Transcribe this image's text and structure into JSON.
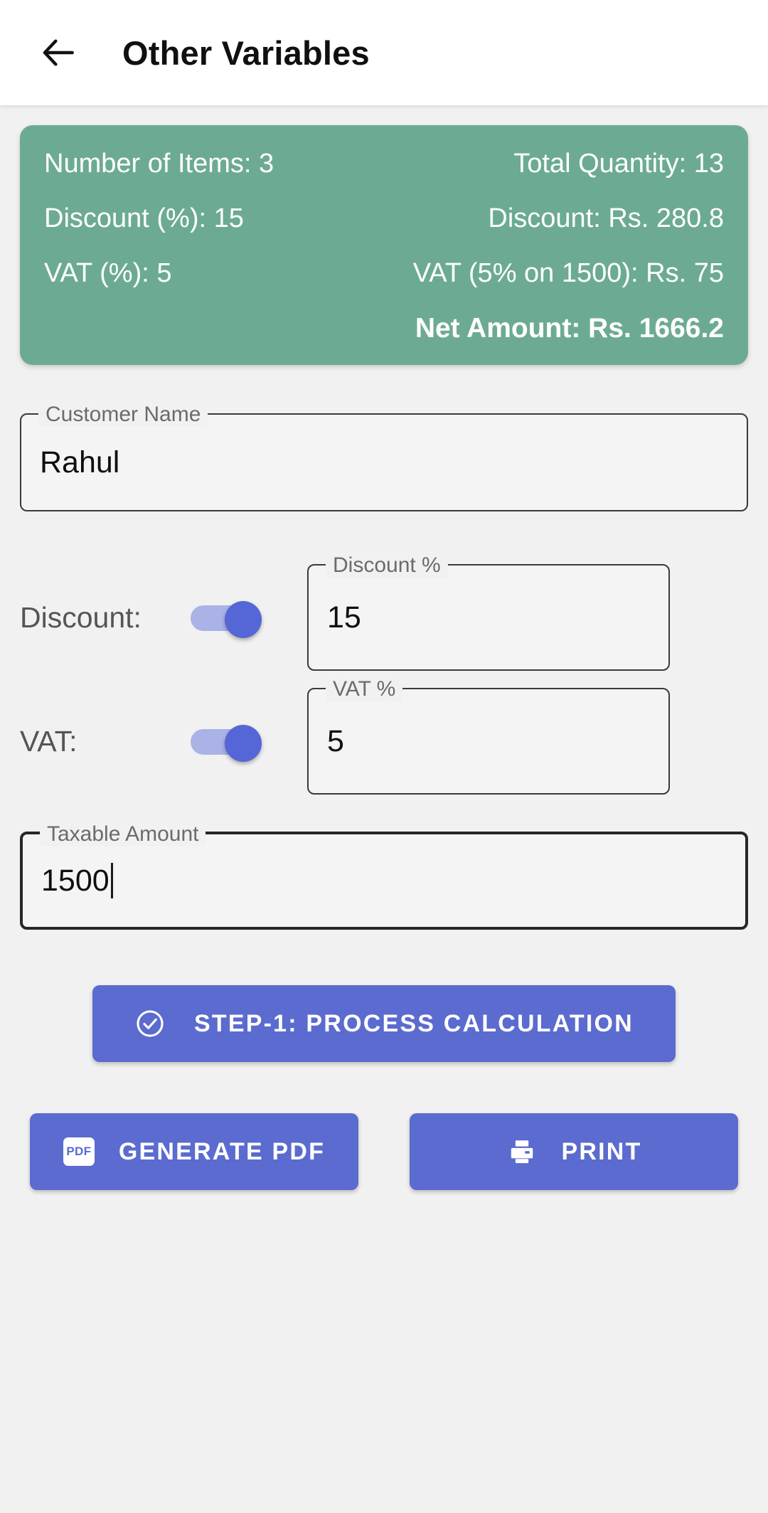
{
  "appbar": {
    "back_icon": "arrow-left-icon",
    "title": "Other Variables"
  },
  "summary": {
    "rows": [
      {
        "left": "Number of Items: 3",
        "right": "Total Quantity: 13"
      },
      {
        "left": "Discount (%): 15",
        "right": "Discount: Rs. 280.8"
      },
      {
        "left": "VAT (%): 5",
        "right": "VAT (5% on 1500): Rs. 75"
      }
    ],
    "net_amount": "Net Amount: Rs. 1666.2",
    "background_color": "#6cab92",
    "text_color": "#ffffff"
  },
  "form": {
    "customer_name": {
      "label": "Customer Name",
      "value": "Rahul",
      "placeholder": "Customer Name"
    },
    "discount": {
      "toggle_label": "Discount:",
      "toggle_state": "on",
      "field_label": "Discount %",
      "value": "15",
      "placeholder": "Discount %"
    },
    "vat": {
      "toggle_label": "VAT:",
      "toggle_state": "on",
      "field_label": "VAT %",
      "value": "5",
      "placeholder": "VAT %"
    },
    "taxable_amount": {
      "label": "Taxable Amount",
      "value": "1500",
      "placeholder": "Taxable Amount",
      "focused": true
    }
  },
  "actions": {
    "step_button": {
      "label": "STEP-1: PROCESS CALCULATION",
      "icon": "check-circle-icon"
    },
    "pdf_button": {
      "label": "GENERATE PDF",
      "icon": "pdf-icon",
      "icon_text": "PDF"
    },
    "print_button": {
      "label": "PRINT",
      "icon": "printer-icon"
    },
    "accent_color": "#5b6bcf"
  }
}
